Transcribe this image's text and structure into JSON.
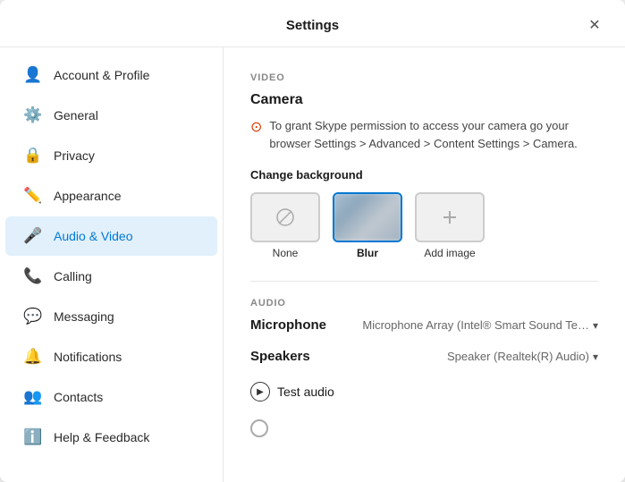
{
  "window": {
    "title": "Settings",
    "close_label": "✕"
  },
  "sidebar": {
    "items": [
      {
        "id": "account",
        "label": "Account & Profile",
        "icon": "👤"
      },
      {
        "id": "general",
        "label": "General",
        "icon": "⚙️"
      },
      {
        "id": "privacy",
        "label": "Privacy",
        "icon": "🔒"
      },
      {
        "id": "appearance",
        "label": "Appearance",
        "icon": "✏️"
      },
      {
        "id": "audio-video",
        "label": "Audio & Video",
        "icon": "🎤",
        "active": true
      },
      {
        "id": "calling",
        "label": "Calling",
        "icon": "📞"
      },
      {
        "id": "messaging",
        "label": "Messaging",
        "icon": "💬"
      },
      {
        "id": "notifications",
        "label": "Notifications",
        "icon": "🔔"
      },
      {
        "id": "contacts",
        "label": "Contacts",
        "icon": "👥"
      },
      {
        "id": "help",
        "label": "Help & Feedback",
        "icon": "ℹ️"
      }
    ]
  },
  "main": {
    "video_section": {
      "section_label": "VIDEO",
      "camera_title": "Camera",
      "warning_text": "To grant Skype permission to access your camera go your browser Settings > Advanced > Content Settings > Camera.",
      "change_background_label": "Change background",
      "bg_options": [
        {
          "id": "none",
          "label": "None",
          "selected": false
        },
        {
          "id": "blur",
          "label": "Blur",
          "selected": true
        },
        {
          "id": "add",
          "label": "Add image",
          "selected": false
        }
      ]
    },
    "audio_section": {
      "section_label": "AUDIO",
      "microphone_label": "Microphone",
      "microphone_value": "Microphone Array (Intel® Smart Sound Te…",
      "speakers_label": "Speakers",
      "speakers_value": "Speaker (Realtek(R) Audio)",
      "test_audio_label": "Test audio"
    }
  }
}
